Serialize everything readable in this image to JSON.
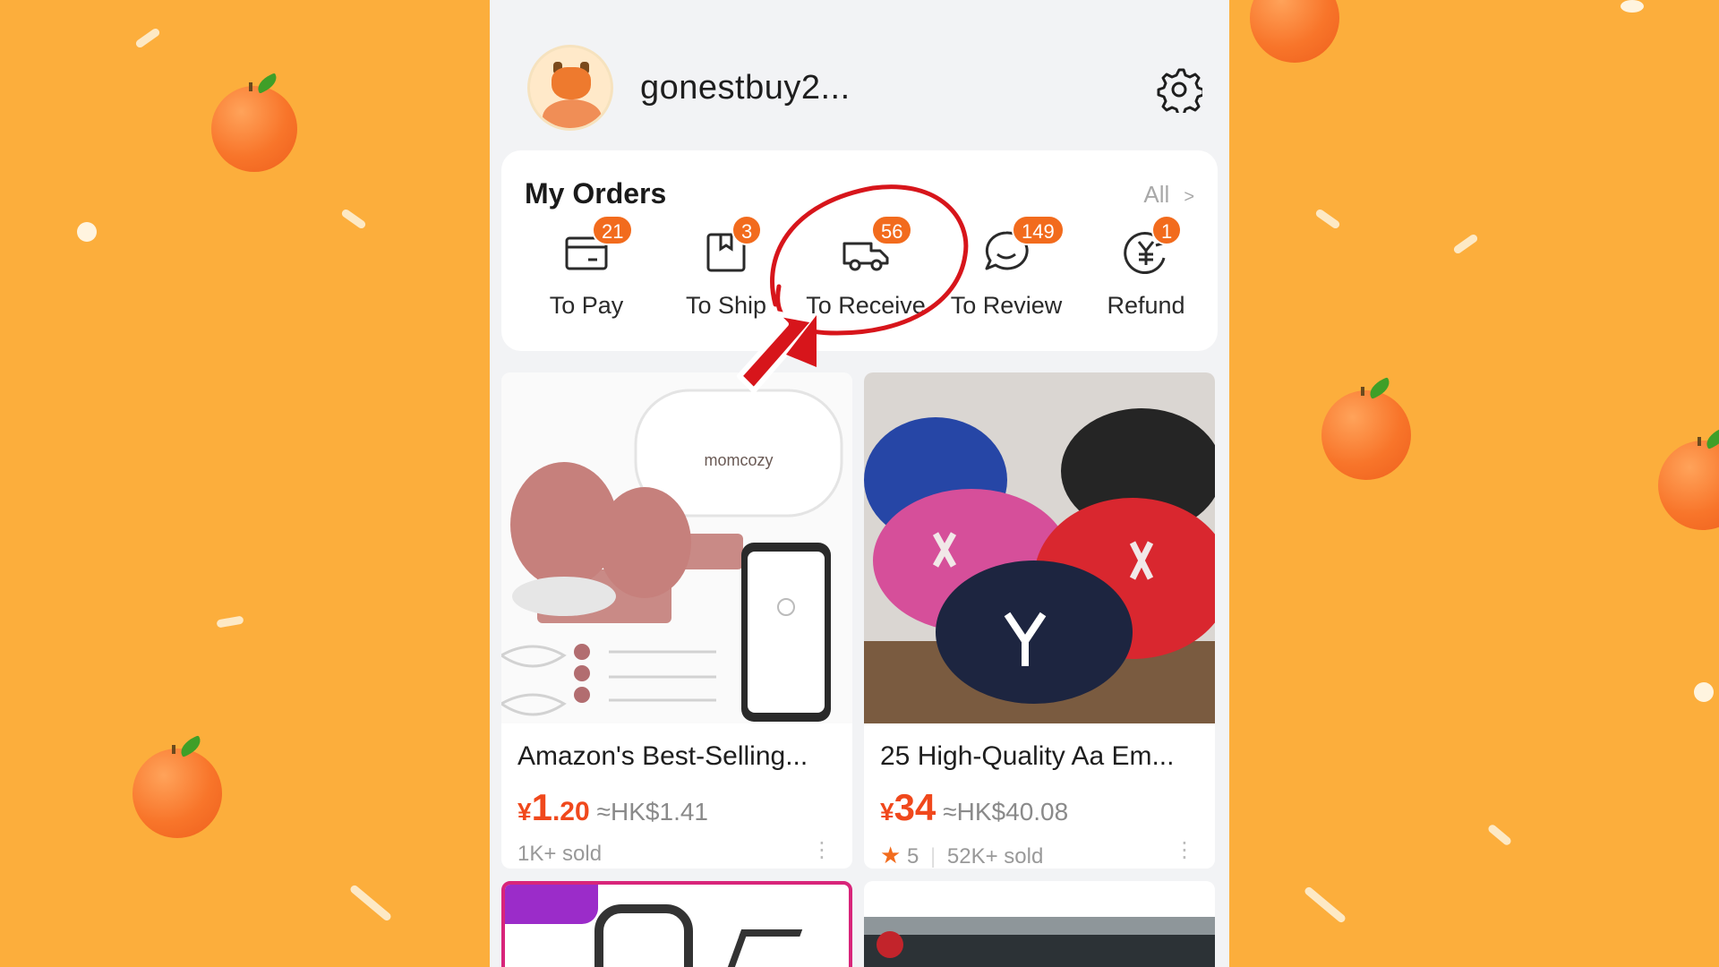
{
  "profile": {
    "username": "gonestbuy2..."
  },
  "orders": {
    "title": "My Orders",
    "all_label": "All",
    "all_chevron": ">",
    "items": [
      {
        "label": "To Pay",
        "badge": "21",
        "icon": "card-icon"
      },
      {
        "label": "To Ship",
        "badge": "3",
        "icon": "package-icon"
      },
      {
        "label": "To Receive",
        "badge": "56",
        "icon": "truck-icon"
      },
      {
        "label": "To Review",
        "badge": "149",
        "icon": "chat-bubble-icon"
      },
      {
        "label": "Refund",
        "badge": "1",
        "icon": "yuan-refund-icon"
      }
    ]
  },
  "products": [
    {
      "title": "Amazon's Best-Selling...",
      "price_currency": "¥",
      "price_int": "1",
      "price_dec": ".20",
      "price_hk": "≈HK$1.41",
      "sold": "1K+ sold",
      "image_text": "momcozy"
    },
    {
      "title": "25 High-Quality Aa Em...",
      "price_currency": "¥",
      "price_int": "34",
      "price_dec": "",
      "price_hk": "≈HK$40.08",
      "rating": "5",
      "sold": "52K+ sold"
    }
  ],
  "colors": {
    "background": "#FCAE3C",
    "accent": "#F26B1D",
    "price": "#F0481C",
    "annotation": "#D7151B"
  }
}
